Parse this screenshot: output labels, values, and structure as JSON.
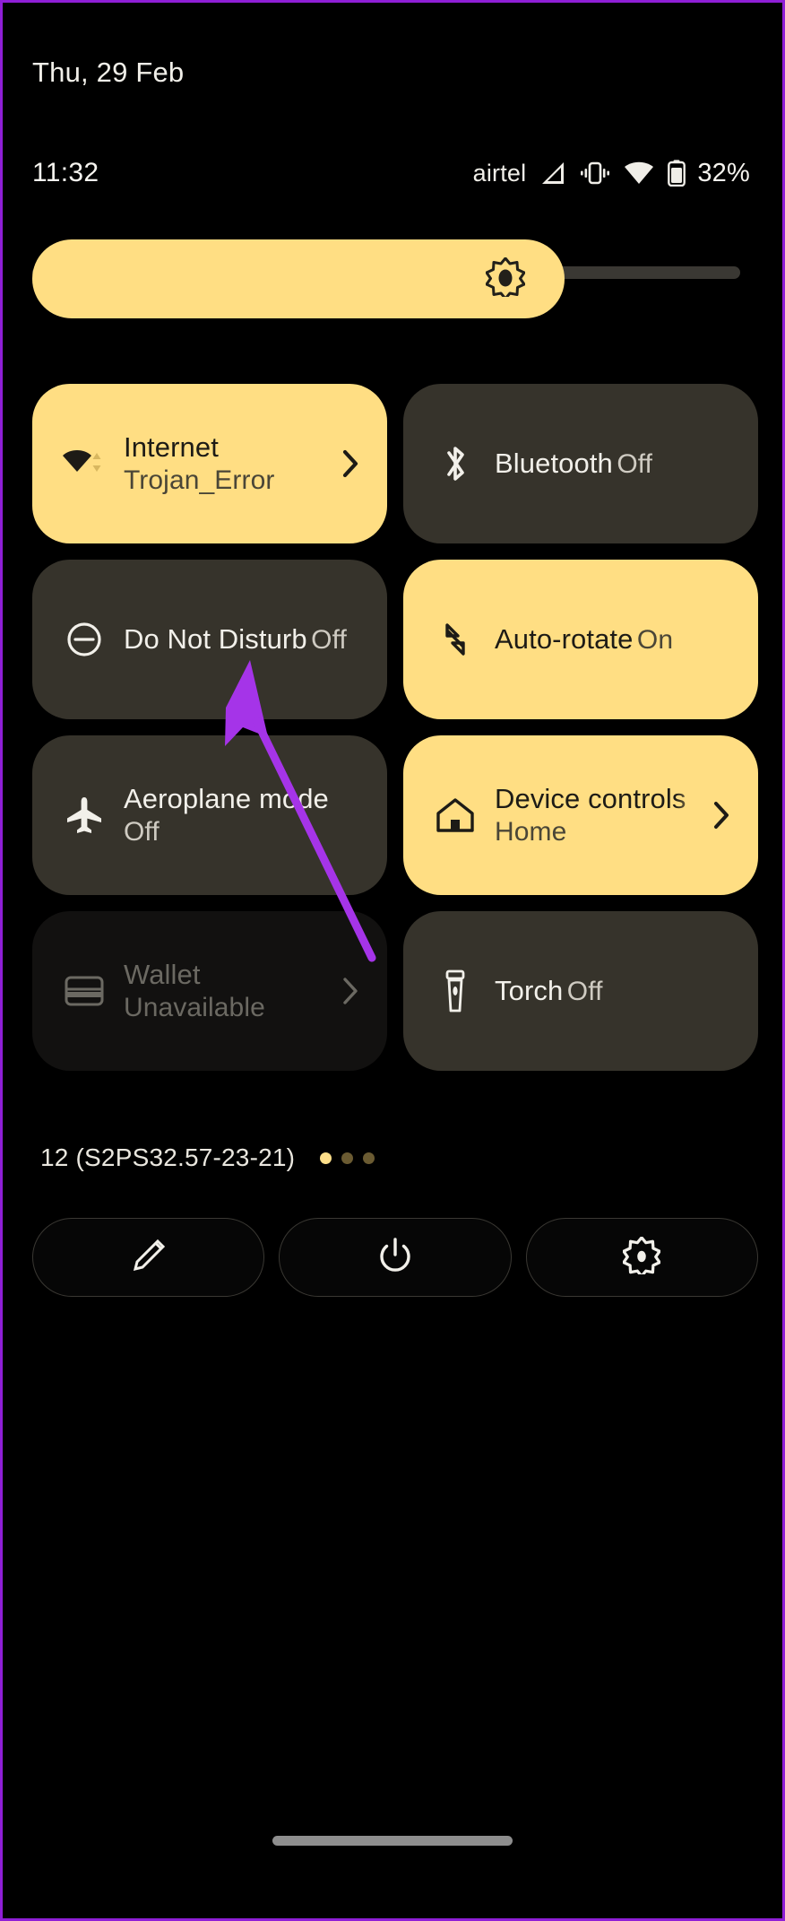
{
  "status": {
    "date": "Thu, 29 Feb",
    "time": "11:32",
    "carrier": "airtel",
    "battery_percent": "32%",
    "icons": [
      "signal-icon",
      "vibrate-icon",
      "wifi-icon",
      "battery-icon"
    ]
  },
  "brightness": {
    "icon": "brightness-icon",
    "level_percent": 75
  },
  "tiles": [
    {
      "title": "Internet",
      "subtitle": "Trojan_Error",
      "icon": "wifi-transfer-icon",
      "state": "on",
      "chevron": true,
      "disabled": false
    },
    {
      "title": "Bluetooth",
      "subtitle": "Off",
      "icon": "bluetooth-icon",
      "state": "off",
      "chevron": false,
      "disabled": false
    },
    {
      "title": "Do Not Disturb",
      "subtitle": "Off",
      "icon": "do-not-disturb-icon",
      "state": "off",
      "chevron": false,
      "disabled": false
    },
    {
      "title": "Auto-rotate",
      "subtitle": "On",
      "icon": "auto-rotate-icon",
      "state": "on",
      "chevron": false,
      "disabled": false
    },
    {
      "title": "Aeroplane mode",
      "subtitle": "Off",
      "icon": "aeroplane-icon",
      "state": "off",
      "chevron": false,
      "disabled": false
    },
    {
      "title": "Device controls",
      "subtitle": "Home",
      "icon": "home-icon",
      "state": "on",
      "chevron": true,
      "disabled": false
    },
    {
      "title": "Wallet",
      "subtitle": "Unavailable",
      "icon": "wallet-icon",
      "state": "off",
      "chevron": true,
      "disabled": true
    },
    {
      "title": "Torch",
      "subtitle": "Off",
      "icon": "torch-icon",
      "state": "off",
      "chevron": false,
      "disabled": false
    }
  ],
  "footer": {
    "build": "12 (S2PS32.57-23-21)",
    "pages": {
      "count": 3,
      "active_index": 0
    },
    "buttons": [
      {
        "name": "edit-button",
        "icon": "pencil-icon"
      },
      {
        "name": "power-button",
        "icon": "power-icon"
      },
      {
        "name": "settings-button",
        "icon": "gear-icon"
      }
    ]
  },
  "colors": {
    "accent_yellow": "#FFDE83",
    "tile_dark": "#36332B",
    "tile_disabled": "#121110",
    "background": "#000000",
    "cursor_purple": "#A534E8",
    "frame_purple": "#8F1FD6"
  },
  "annotation": {
    "cursor": "arrow-cursor",
    "points_at": "Do Not Disturb"
  }
}
